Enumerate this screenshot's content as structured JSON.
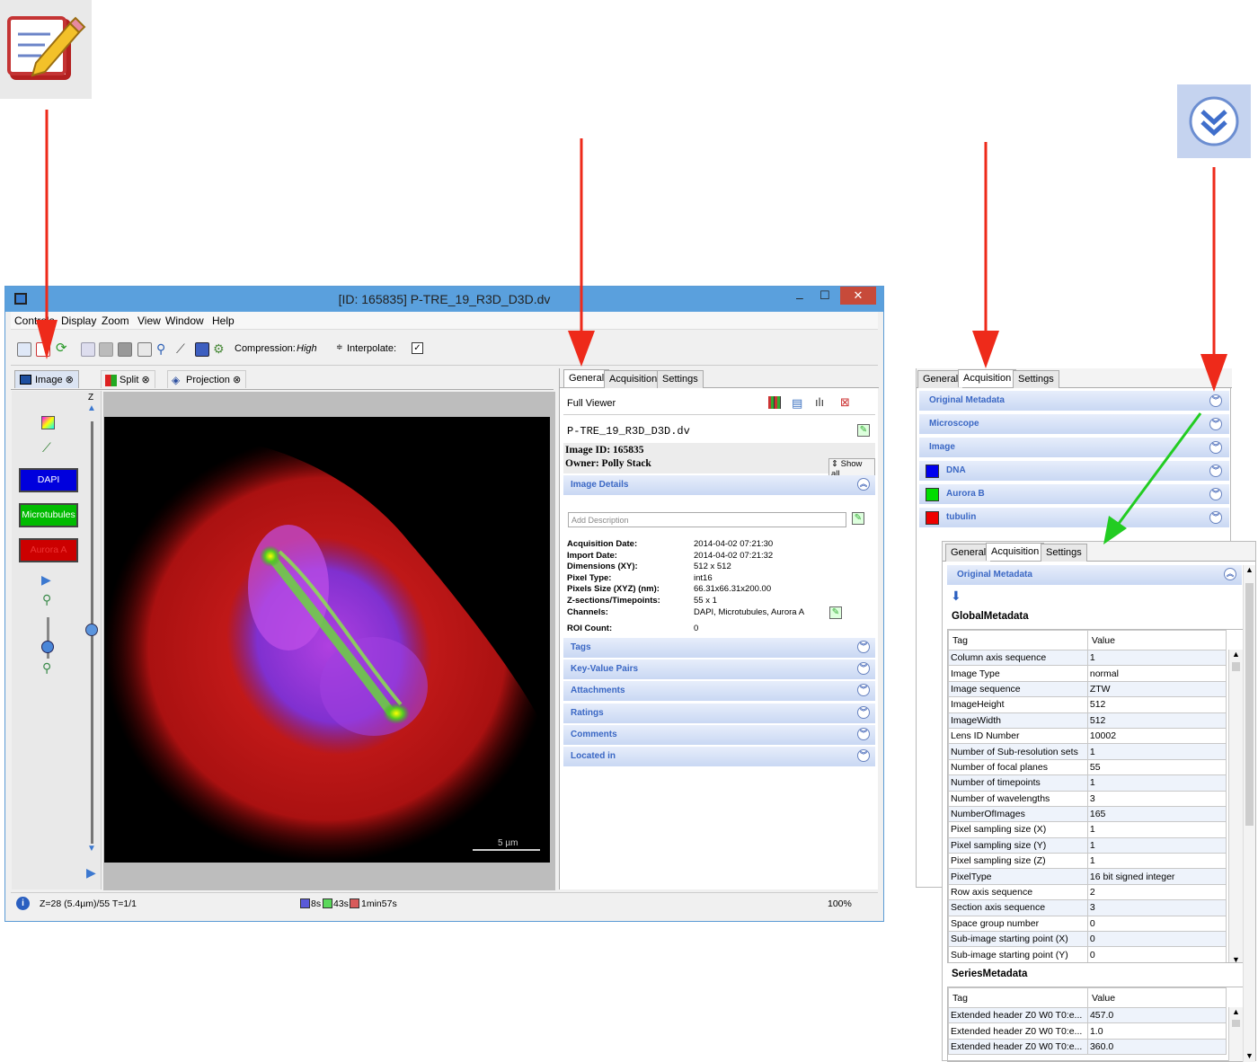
{
  "window": {
    "title": "[ID: 165835] P-TRE_19_R3D_D3D.dv",
    "minimize": "–",
    "maximize": "☐",
    "close": "✕"
  },
  "menubar": [
    "Controls",
    "Display",
    "Zoom",
    "View",
    "Window",
    "Help"
  ],
  "toolbar": {
    "compression_label": "Compression:",
    "compression_value": "High",
    "interpolate_label": "Interpolate:",
    "interpolate_checked": true
  },
  "viewer_tabs": [
    "Image",
    "Split",
    "Projection"
  ],
  "left_panel": {
    "z_label": "Z",
    "channels": [
      {
        "label": "DAPI",
        "color": "#0000dd",
        "text_color": "#ffffff"
      },
      {
        "label": "Microtubules",
        "color": "#00bb00",
        "text_color": "#ffffff"
      },
      {
        "label": "Aurora A",
        "color": "#cc0000",
        "text_color": "#ee3333"
      }
    ]
  },
  "scalebar": "5 µm",
  "status": {
    "position": "Z=28 (5.4µm)/55 T=1/1",
    "timings": [
      "8s",
      "43s",
      "1min57s"
    ],
    "zoom": "100%"
  },
  "right_panel": {
    "tabs": [
      "General",
      "Acquisition",
      "Settings"
    ],
    "full_viewer": "Full Viewer",
    "filename": "P-TRE_19_R3D_D3D.dv",
    "image_id": "Image ID: 165835",
    "owner": "Owner: Polly Stack",
    "show_all": "Show all",
    "image_details": "Image Details",
    "add_description": "Add Description",
    "details": [
      {
        "label": "Acquisition Date:",
        "value": "2014-04-02 07:21:30"
      },
      {
        "label": "Import Date:",
        "value": "2014-04-02 07:21:32"
      },
      {
        "label": "Dimensions (XY):",
        "value": "512 x 512"
      },
      {
        "label": "Pixel Type:",
        "value": "int16"
      },
      {
        "label": "Pixels Size (XYZ) (nm):",
        "value": "66.31x66.31x200.00"
      },
      {
        "label": "Z-sections/Timepoints:",
        "value": "55 x 1"
      },
      {
        "label": "Channels:",
        "value": "DAPI, Microtubules, Aurora A"
      }
    ],
    "roi_label": "ROI Count:",
    "roi_value": "0",
    "sections": [
      "Tags",
      "Key-Value Pairs",
      "Attachments",
      "Ratings",
      "Comments",
      "Located in"
    ]
  },
  "acq_panel": {
    "tabs": [
      "General",
      "Acquisition",
      "Settings"
    ],
    "rows": [
      {
        "label": "Original Metadata",
        "swatch": ""
      },
      {
        "label": "Microscope",
        "swatch": ""
      },
      {
        "label": "Image",
        "swatch": ""
      },
      {
        "label": "DNA",
        "swatch": "#0000ee"
      },
      {
        "label": "Aurora B",
        "swatch": "#00dd00"
      },
      {
        "label": "tubulin",
        "swatch": "#ee0000"
      }
    ]
  },
  "meta_panel": {
    "tabs": [
      "General",
      "Acquisition",
      "Settings"
    ],
    "header": "Original Metadata",
    "global_title": "GlobalMetadata",
    "col_tag": "Tag",
    "col_value": "Value",
    "global_rows": [
      [
        "Column axis sequence",
        "1"
      ],
      [
        "Image Type",
        "normal"
      ],
      [
        "Image sequence",
        "ZTW"
      ],
      [
        "ImageHeight",
        "512"
      ],
      [
        "ImageWidth",
        "512"
      ],
      [
        "Lens ID Number",
        "10002"
      ],
      [
        "Number of Sub-resolution sets",
        "1"
      ],
      [
        "Number of focal planes",
        "55"
      ],
      [
        "Number of timepoints",
        "1"
      ],
      [
        "Number of wavelengths",
        "3"
      ],
      [
        "NumberOfImages",
        "165"
      ],
      [
        "Pixel sampling size (X)",
        "1"
      ],
      [
        "Pixel sampling size (Y)",
        "1"
      ],
      [
        "Pixel sampling size (Z)",
        "1"
      ],
      [
        "PixelType",
        "16 bit signed integer"
      ],
      [
        "Row axis sequence",
        "2"
      ],
      [
        "Section axis sequence",
        "3"
      ],
      [
        "Space group number",
        "0"
      ],
      [
        "Sub-image starting point (X)",
        "0"
      ],
      [
        "Sub-image starting point (Y)",
        "0"
      ]
    ],
    "series_title": "SeriesMetadata",
    "series_rows": [
      [
        "Extended header Z0 W0 T0:e...",
        "457.0"
      ],
      [
        "Extended header Z0 W0 T0:e...",
        "1.0"
      ],
      [
        "Extended header Z0 W0 T0:e...",
        "360.0"
      ]
    ]
  },
  "colors": {
    "arrow_red": "#ee2a1a",
    "arrow_green": "#22cc22",
    "panel_header": "#3a67c4",
    "titlebar": "#5aa0dd"
  }
}
